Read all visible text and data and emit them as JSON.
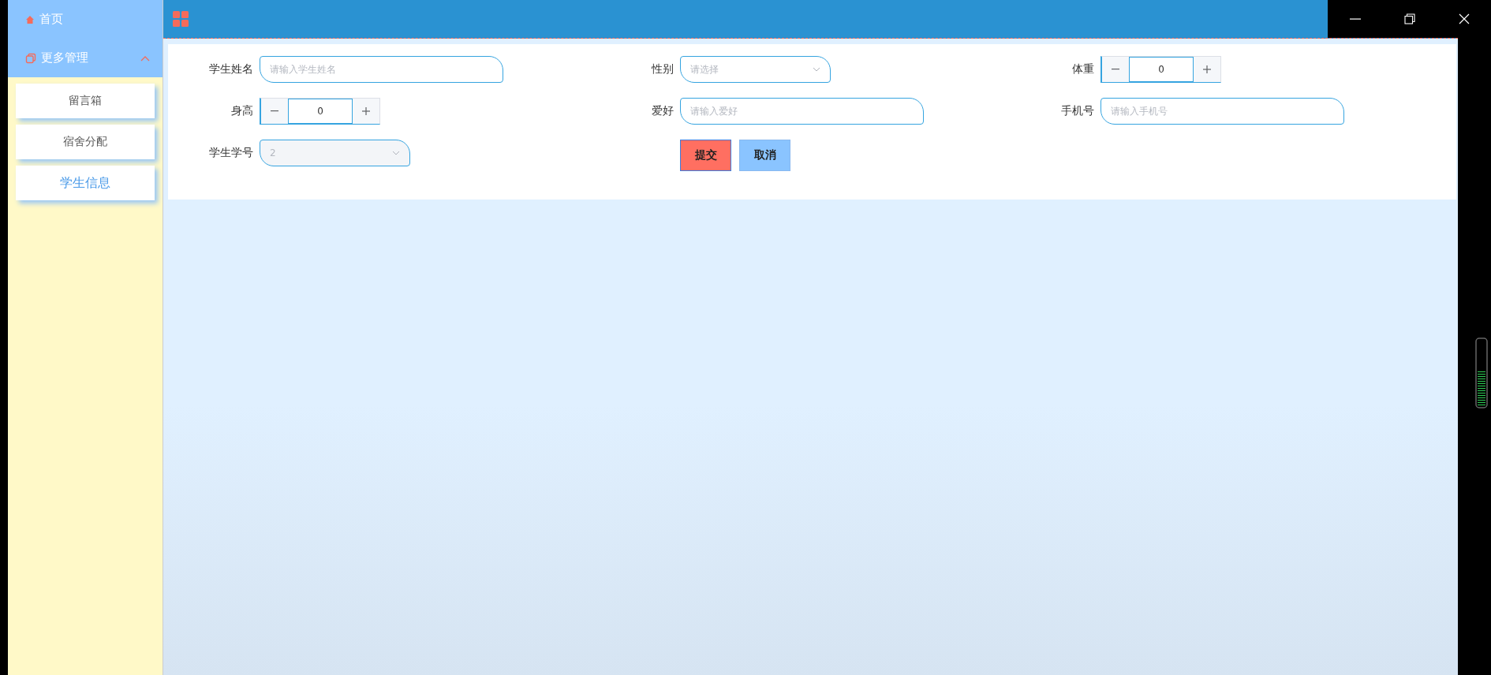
{
  "sidebar": {
    "items": [
      {
        "label": "首页",
        "kind": "link"
      },
      {
        "label": "更多管理",
        "kind": "group",
        "expanded": true,
        "children": [
          {
            "label": "留言箱",
            "selected": false
          },
          {
            "label": "宿舍分配",
            "selected": false
          },
          {
            "label": "学生信息",
            "selected": true
          }
        ]
      }
    ]
  },
  "form": {
    "fields": [
      {
        "label": "学生姓名",
        "kind": "text",
        "placeholder": "请输入学生姓名"
      },
      {
        "label": "性别",
        "kind": "select",
        "placeholder": "请选择",
        "disabled": false
      },
      {
        "label": "体重",
        "kind": "number",
        "value": "0"
      },
      {
        "label": "身高",
        "kind": "number",
        "value": "0"
      },
      {
        "label": "爱好",
        "kind": "text",
        "placeholder": "请输入爱好"
      },
      {
        "label": "手机号",
        "kind": "text",
        "placeholder": "请输入手机号"
      },
      {
        "label": "学生学号",
        "kind": "select",
        "value": "2",
        "disabled": true
      }
    ],
    "buttons": [
      {
        "label": "提交",
        "kind": "primary"
      },
      {
        "label": "取消",
        "kind": "secondary"
      }
    ]
  }
}
